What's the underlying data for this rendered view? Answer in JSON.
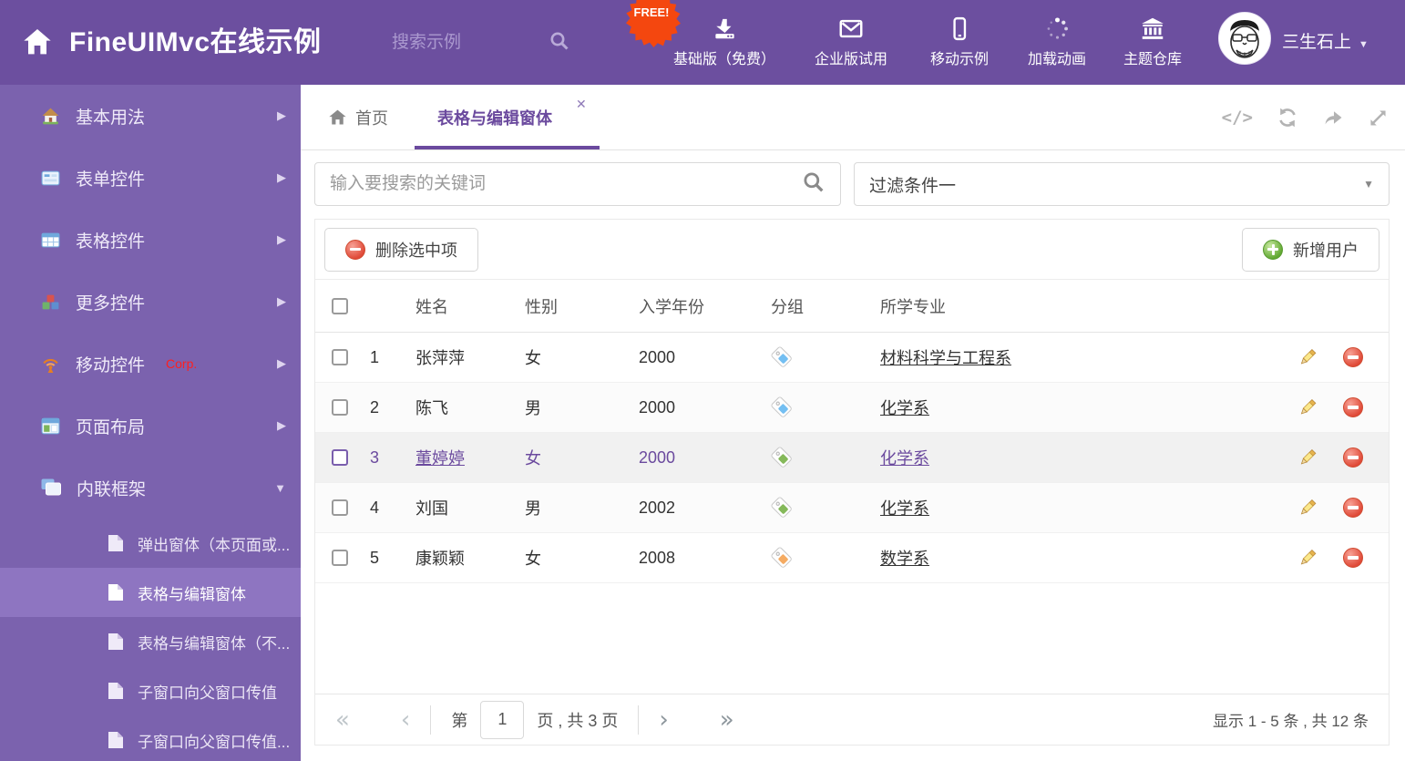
{
  "app": {
    "title": "FineUIMvc在线示例",
    "search_placeholder": "搜索示例",
    "free_badge": "FREE!",
    "username": "三生石上",
    "nav": [
      {
        "label": "基础版（免费）",
        "icon": "download-icon"
      },
      {
        "label": "企业版试用",
        "icon": "envelope-icon"
      },
      {
        "label": "移动示例",
        "icon": "mobile-icon"
      },
      {
        "label": "加载动画",
        "icon": "spinner-icon"
      },
      {
        "label": "主题仓库",
        "icon": "bank-icon"
      }
    ]
  },
  "sidebar": {
    "items": [
      {
        "label": "基本用法"
      },
      {
        "label": "表单控件"
      },
      {
        "label": "表格控件"
      },
      {
        "label": "更多控件"
      },
      {
        "label": "移动控件",
        "badge": "Corp."
      },
      {
        "label": "页面布局"
      },
      {
        "label": "内联框架",
        "expanded": true
      }
    ],
    "subitems": [
      {
        "label": "弹出窗体（本页面或...",
        "selected": false
      },
      {
        "label": "表格与编辑窗体",
        "selected": true
      },
      {
        "label": "表格与编辑窗体（不...",
        "selected": false
      },
      {
        "label": "子窗口向父窗口传值",
        "selected": false
      },
      {
        "label": "子窗口向父窗口传值...",
        "selected": false
      }
    ]
  },
  "tabs": {
    "home": "首页",
    "active": "表格与编辑窗体",
    "close": "✕"
  },
  "filters": {
    "search_placeholder": "输入要搜索的关键词",
    "dropdown_value": "过滤条件一"
  },
  "toolbar": {
    "delete_label": "删除选中项",
    "add_label": "新增用户"
  },
  "table": {
    "columns": {
      "name": "姓名",
      "gender": "性别",
      "year": "入学年份",
      "group": "分组",
      "major": "所学专业"
    },
    "rows": [
      {
        "num": "1",
        "name": "张萍萍",
        "gender": "女",
        "year": "2000",
        "tag_color": "#74bff2",
        "major": "材料科学与工程系",
        "selected": false
      },
      {
        "num": "2",
        "name": "陈飞",
        "gender": "男",
        "year": "2000",
        "tag_color": "#74bff2",
        "major": "化学系",
        "selected": false
      },
      {
        "num": "3",
        "name": "董婷婷",
        "gender": "女",
        "year": "2000",
        "tag_color": "#85b95a",
        "major": "化学系",
        "selected": true
      },
      {
        "num": "4",
        "name": "刘国",
        "gender": "男",
        "year": "2002",
        "tag_color": "#85b95a",
        "major": "化学系",
        "selected": false
      },
      {
        "num": "5",
        "name": "康颖颖",
        "gender": "女",
        "year": "2008",
        "tag_color": "#f5ab62",
        "major": "数学系",
        "selected": false
      }
    ]
  },
  "pagination": {
    "prefix": "第",
    "current_page": "1",
    "suffix": "页 , 共 3 页",
    "first": "«",
    "prev": "‹",
    "next": "›",
    "last": "»",
    "summary": "显示 1 - 5 条 , 共 12 条"
  },
  "colors": {
    "header_bg": "#6C4F9F",
    "sidebar_bg": "#7B62AE",
    "sidebar_selected": "#8E75C1",
    "accent": "#6B4A9E",
    "free_badge": "#F4470F",
    "delete_red": "#E2503C",
    "add_green": "#6FB93C",
    "tag_blue": "#74bff2",
    "tag_green": "#85b95a",
    "tag_orange": "#f5ab62"
  }
}
